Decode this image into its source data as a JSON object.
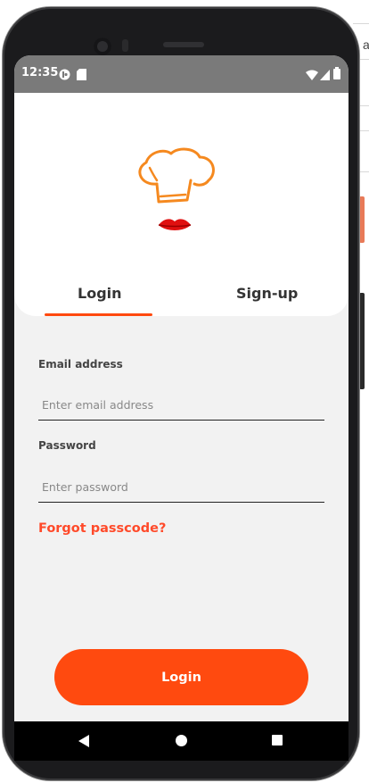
{
  "status_bar": {
    "time": "12:35",
    "icons": [
      "lineage-icon",
      "sd-card-icon",
      "wifi-icon",
      "signal-icon",
      "battery-icon"
    ]
  },
  "desktop_edge_text": "a",
  "brand": {
    "logo": "chef-hat-lips-logo",
    "accent": "#ff4a0f",
    "hat_color": "#f5891f",
    "lips_color": "#e01010"
  },
  "tabs": [
    {
      "label": "Login",
      "selected": true
    },
    {
      "label": "Sign-up",
      "selected": false
    }
  ],
  "form": {
    "email_label": "Email address",
    "email_placeholder": "Enter email address",
    "email_value": "",
    "password_label": "Password",
    "password_placeholder": "Enter password",
    "password_value": "",
    "forgot_link": "Forgot passcode?",
    "submit_label": "Login"
  },
  "nav_bar": {
    "icons": [
      "back-icon",
      "home-icon",
      "recents-icon"
    ]
  }
}
